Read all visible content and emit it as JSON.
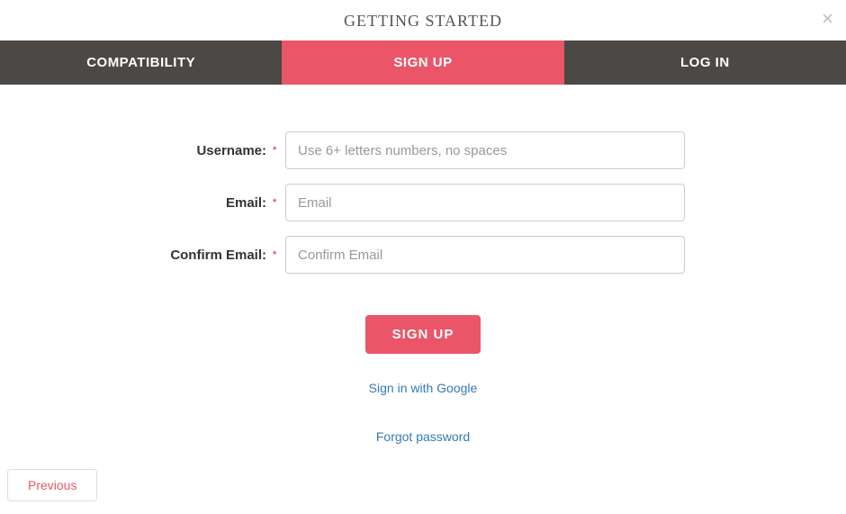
{
  "header": {
    "title": "GETTING STARTED",
    "close": "×"
  },
  "tabs": {
    "compatibility": "COMPATIBILITY",
    "signup": "SIGN UP",
    "login": "LOG IN"
  },
  "form": {
    "username_label": "Username:",
    "username_placeholder": "Use 6+ letters numbers, no spaces",
    "email_label": "Email:",
    "email_placeholder": "Email",
    "confirm_email_label": "Confirm Email:",
    "confirm_email_placeholder": "Confirm Email",
    "required": "*"
  },
  "actions": {
    "signup": "SIGN UP",
    "google": "Sign in with Google",
    "forgot": "Forgot password",
    "previous": "Previous"
  }
}
